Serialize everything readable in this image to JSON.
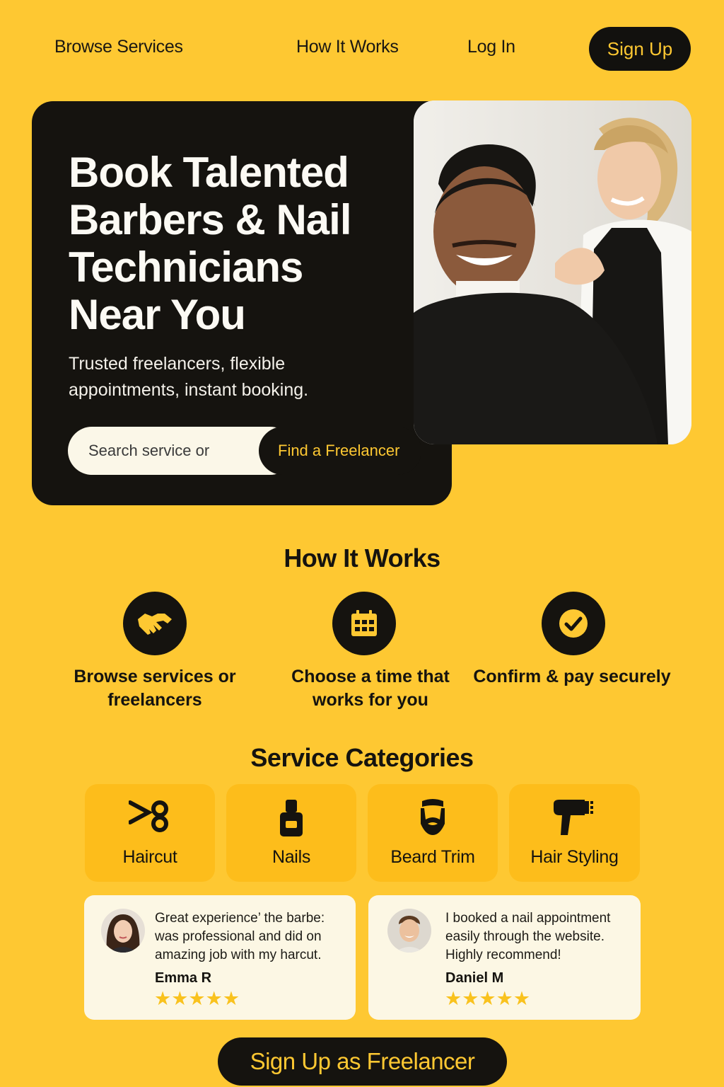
{
  "nav": {
    "browse_services": "Browse Services",
    "how_it_works": "How It Works",
    "log_in": "Log In",
    "sign_up": "Sign Up"
  },
  "hero": {
    "title": "Book Talented Barbers & Nail Technicians Near You",
    "subtitle": "Trusted freelancers, flexible appointments, instant booking.",
    "search_placeholder": "Search service or",
    "search_button": "Find a Freelancer"
  },
  "how_it_works": {
    "title": "How It Works",
    "steps": [
      {
        "icon": "handshake-icon",
        "label": "Browse services or freelancers"
      },
      {
        "icon": "calendar-icon",
        "label": "Choose a time that works for you"
      },
      {
        "icon": "checkmark-icon",
        "label": "Confirm & pay securely"
      }
    ]
  },
  "categories": {
    "title": "Service Categories",
    "items": [
      {
        "icon": "scissors-icon",
        "label": "Haircut"
      },
      {
        "icon": "nail-polish-icon",
        "label": "Nails"
      },
      {
        "icon": "beard-icon",
        "label": "Beard Trim"
      },
      {
        "icon": "hair-dryer-icon",
        "label": "Hair Styling"
      }
    ]
  },
  "testimonials": [
    {
      "text": "Great experience’ the barbe: was professional and did on amazing job with my harcut.",
      "name": "Emma R",
      "stars": "★★★★★"
    },
    {
      "text": "I booked a nail appointment easily through the website. Highly recommend!",
      "name": "Daniel M",
      "stars": "★★★★★"
    }
  ],
  "cta": {
    "label": "Sign Up as Freelancer"
  },
  "colors": {
    "accent": "#fec832",
    "dark": "#15130f",
    "card": "#fdbd1b",
    "review_bg": "#fcf7e4",
    "star": "#f9c21e"
  }
}
